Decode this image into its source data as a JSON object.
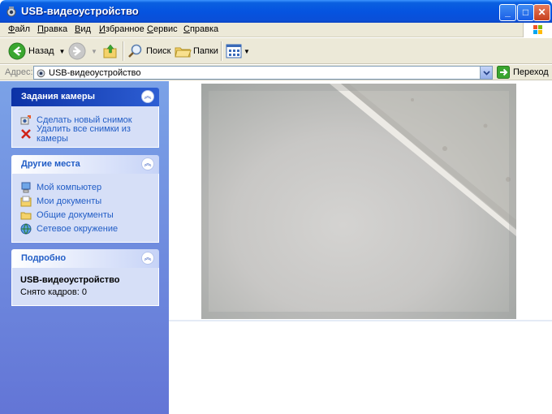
{
  "window": {
    "title": "USB-видеоустройство"
  },
  "menu": {
    "items": [
      {
        "label": "Файл",
        "u": "Ф",
        "rest": "айл"
      },
      {
        "label": "Правка",
        "u": "П",
        "rest": "равка"
      },
      {
        "label": "Вид",
        "u": "В",
        "rest": "ид"
      },
      {
        "label": "Избранное",
        "u": "И",
        "rest": "збранное"
      },
      {
        "label": "Сервис",
        "u": "С",
        "rest": "ервис"
      },
      {
        "label": "Справка",
        "u": "С",
        "rest": "правка"
      }
    ]
  },
  "toolbar": {
    "back_label": "Назад",
    "search_label": "Поиск",
    "folders_label": "Папки"
  },
  "address": {
    "label": "Адрес:",
    "value": "USB-видеоустройство",
    "go_label": "Переход"
  },
  "camera_tasks": {
    "title": "Задания камеры",
    "items": [
      {
        "label": "Сделать новый снимок",
        "icon": "camera-snapshot-icon"
      },
      {
        "label": "Удалить все снимки из камеры",
        "icon": "delete-x-icon"
      }
    ]
  },
  "other_places": {
    "title": "Другие места",
    "items": [
      {
        "label": "Мой компьютер",
        "icon": "my-computer-icon"
      },
      {
        "label": "Мои документы",
        "icon": "my-documents-icon"
      },
      {
        "label": "Общие документы",
        "icon": "shared-documents-icon"
      },
      {
        "label": "Сетевое окружение",
        "icon": "network-icon"
      }
    ]
  },
  "details": {
    "title": "Подробно",
    "name": "USB-видеоустройство",
    "frames_text": "Снято кадров: 0"
  },
  "colors": {
    "titlebar": "#0554e0",
    "taskpane": "#7ba2e7",
    "link": "#215dc6"
  }
}
